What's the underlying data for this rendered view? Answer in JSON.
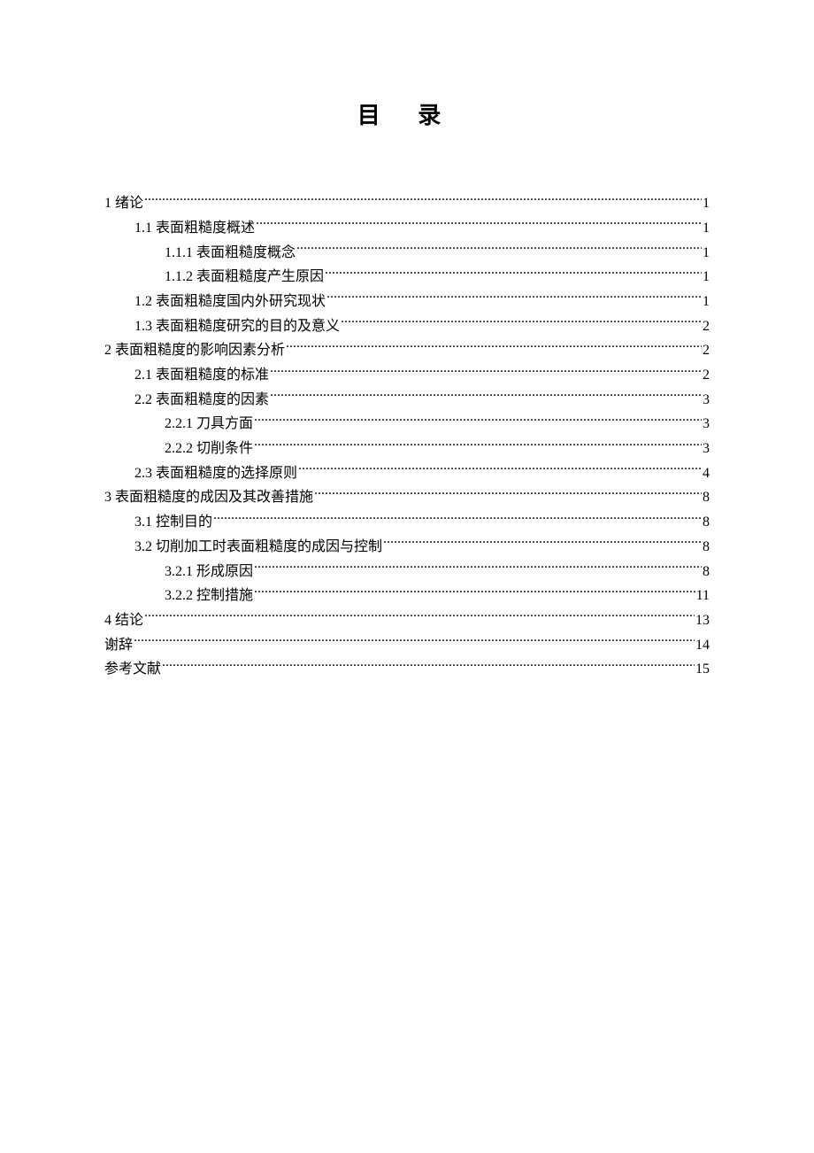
{
  "title": "目 录",
  "toc": [
    {
      "indent": 0,
      "label": "1  绪论",
      "page": "1"
    },
    {
      "indent": 1,
      "label": "1.1 表面粗糙度概述",
      "page": "1"
    },
    {
      "indent": 2,
      "label": "1.1.1 表面粗糙度概念",
      "page": "1"
    },
    {
      "indent": 2,
      "label": "1.1.2 表面粗糙度产生原因",
      "page": "1"
    },
    {
      "indent": 1,
      "label": "1.2 表面粗糙度国内外研究现状",
      "page": "1"
    },
    {
      "indent": 1,
      "label": "1.3 表面粗糙度研究的目的及意义",
      "page": "2"
    },
    {
      "indent": 0,
      "label": "2  表面粗糙度的影响因素分析",
      "page": "2"
    },
    {
      "indent": 1,
      "label": "2.1 表面粗糙度的标准",
      "page": "2"
    },
    {
      "indent": 1,
      "label": "2.2 表面粗糙度的因素",
      "page": "3"
    },
    {
      "indent": 2,
      "label": "2.2.1  刀具方面",
      "page": "3"
    },
    {
      "indent": 2,
      "label": "2.2.2 切削条件",
      "page": "3"
    },
    {
      "indent": 1,
      "label": "2.3 表面粗糙度的选择原则",
      "page": "4"
    },
    {
      "indent": 0,
      "label": "3  表面粗糙度的成因及其改善措施",
      "page": "8"
    },
    {
      "indent": 1,
      "label": "3.1 控制目的",
      "page": "8"
    },
    {
      "indent": 1,
      "label": "3.2 切削加工时表面粗糙度的成因与控制",
      "page": "8"
    },
    {
      "indent": 2,
      "label": "3.2.1 形成原因",
      "page": "8"
    },
    {
      "indent": 2,
      "label": "3.2.2  控制措施",
      "page": "11"
    },
    {
      "indent": 0,
      "label": "4  结论",
      "page": "13"
    },
    {
      "indent": 0,
      "label": "谢辞",
      "page": "14"
    },
    {
      "indent": 0,
      "label": "参考文献",
      "page": "15"
    }
  ]
}
